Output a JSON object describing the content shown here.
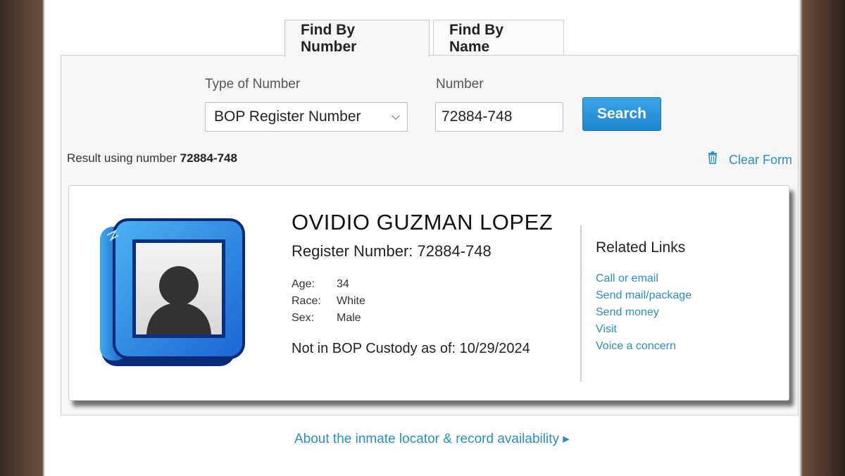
{
  "tabs": [
    {
      "label": "Find By Number",
      "active": true
    },
    {
      "label": "Find By Name",
      "active": false
    }
  ],
  "search_form": {
    "type_label": "Type of Number",
    "type_selected": "BOP Register Number",
    "number_label": "Number",
    "number_value": "72884-748",
    "search_button": "Search"
  },
  "result": {
    "prefix": "Result using number",
    "number": "72884-748",
    "clear_label": "Clear Form"
  },
  "inmate": {
    "name": "OVIDIO GUZMAN LOPEZ",
    "register": "Register Number: 72884-748",
    "details": [
      {
        "key": "Age:",
        "value": "34"
      },
      {
        "key": "Race:",
        "value": "White"
      },
      {
        "key": "Sex:",
        "value": "Male"
      }
    ],
    "custody": "Not in BOP Custody as of: 10/29/2024"
  },
  "related": {
    "title": "Related Links",
    "links": [
      "Call or email",
      "Send mail/package",
      "Send money",
      "Visit",
      "Voice a concern"
    ]
  },
  "footer": {
    "about_link": "About the inmate locator & record availability ▸"
  },
  "icons": {
    "avatar": "person-silhouette-frame-icon",
    "clear": "trash-icon",
    "select": "chevron-down-icon"
  },
  "colors": {
    "accent": "#2a8fc0",
    "button": "#1c86d1",
    "avatar_blue": "#1f6fd6"
  }
}
